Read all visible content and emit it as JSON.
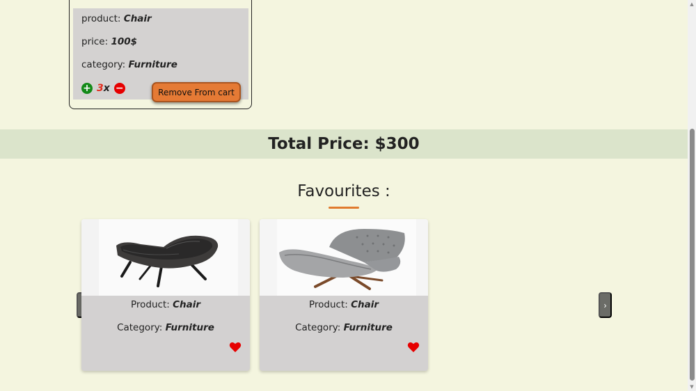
{
  "cart": {
    "product_label": "product:",
    "product_value": "Chair",
    "price_label": "price:",
    "price_value": "100$",
    "category_label": "category:",
    "category_value": "Furniture",
    "plus_icon": "+",
    "minus_icon": "−",
    "quantity": "3",
    "quantity_suffix": "x",
    "remove_label": "Remove From cart"
  },
  "total": {
    "text": "Total Price: $300"
  },
  "favourites": {
    "title": "Favourites :",
    "items": [
      {
        "product_label": "Product:",
        "product_value": "Chair",
        "category_label": "Category:",
        "category_value": "Furniture"
      },
      {
        "product_label": "Product:",
        "product_value": "Chair",
        "category_label": "Category:",
        "category_value": "Furniture"
      }
    ],
    "prev_label": "‹",
    "next_label": "›"
  },
  "colors": {
    "background": "#f4f5df",
    "accent": "#e57a35",
    "total_bar": "#dbe4cb",
    "card": "#d3d1d1",
    "heart": "#e60000",
    "plus": "#138a18"
  }
}
